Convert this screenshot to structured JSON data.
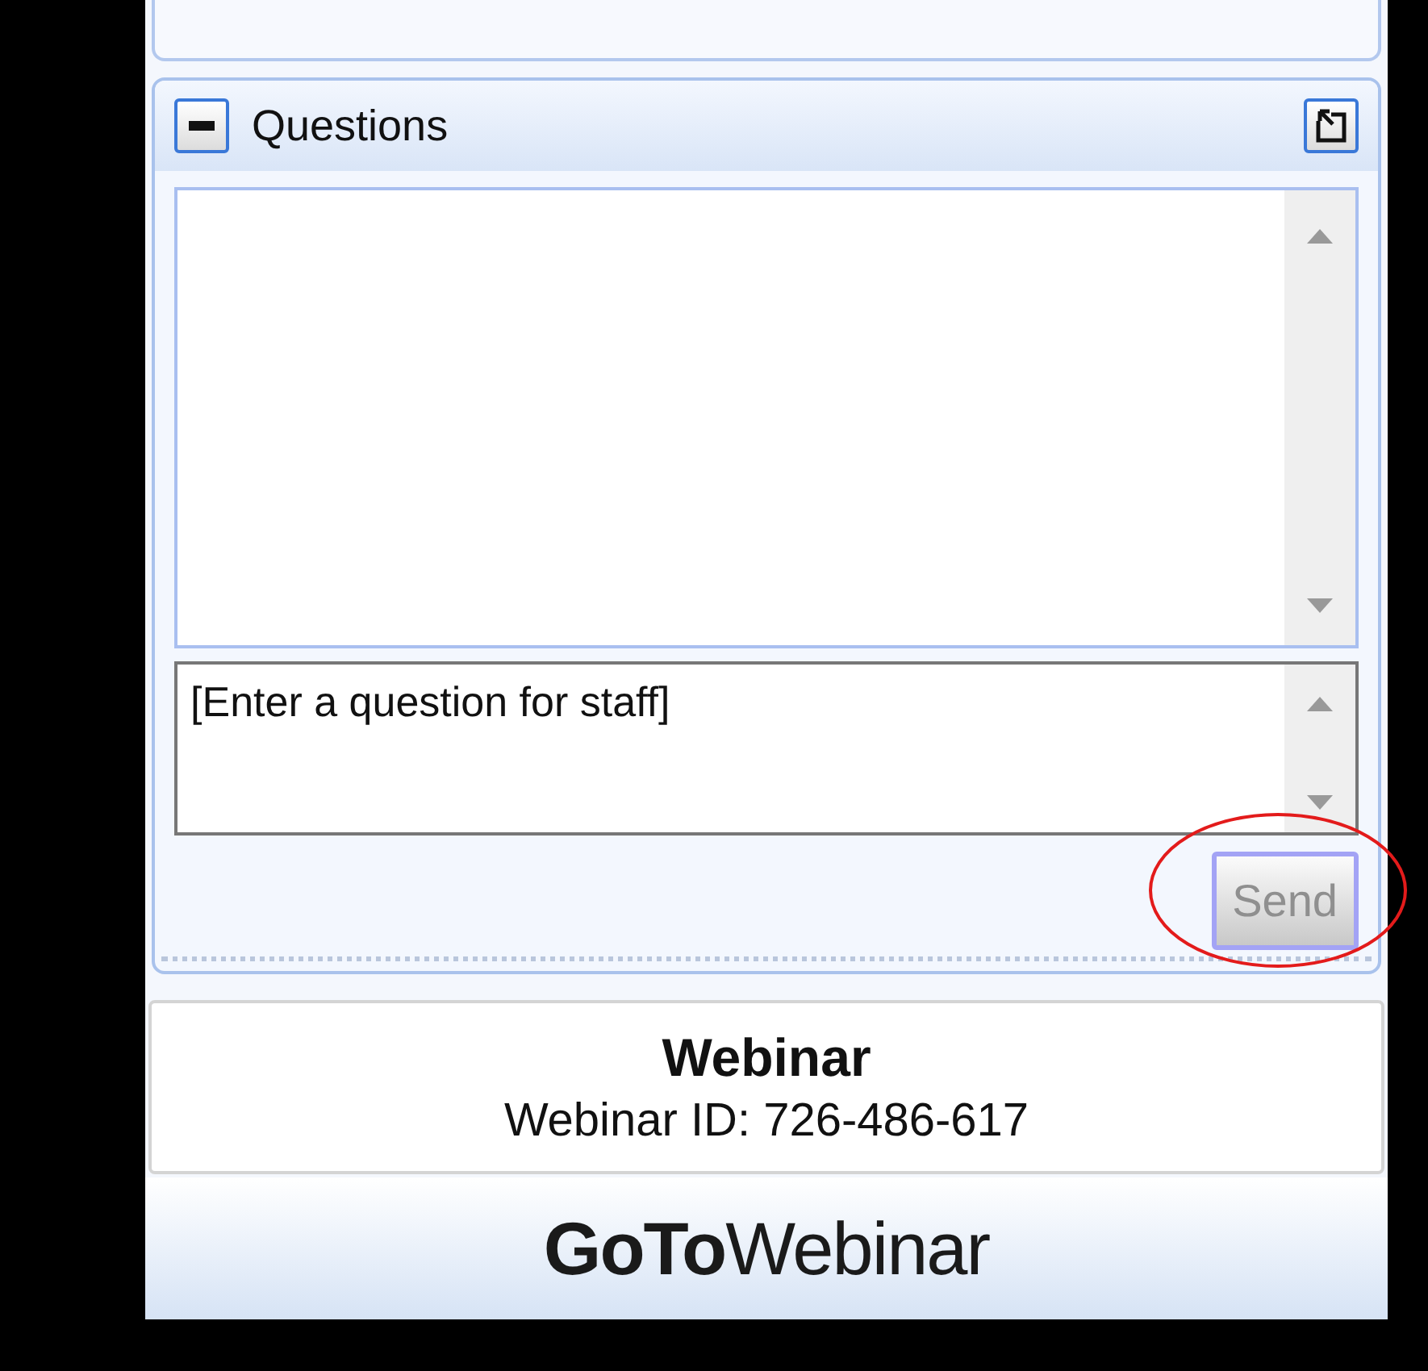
{
  "questions_panel": {
    "title": "Questions"
  },
  "question_input": {
    "placeholder": "[Enter a question for staff]"
  },
  "send_button": {
    "label": "Send",
    "disabled": true
  },
  "webinar_info": {
    "title": "Webinar",
    "id_line": "Webinar ID: 726-486-617"
  },
  "logo": "**GoTo**Webinar"
}
